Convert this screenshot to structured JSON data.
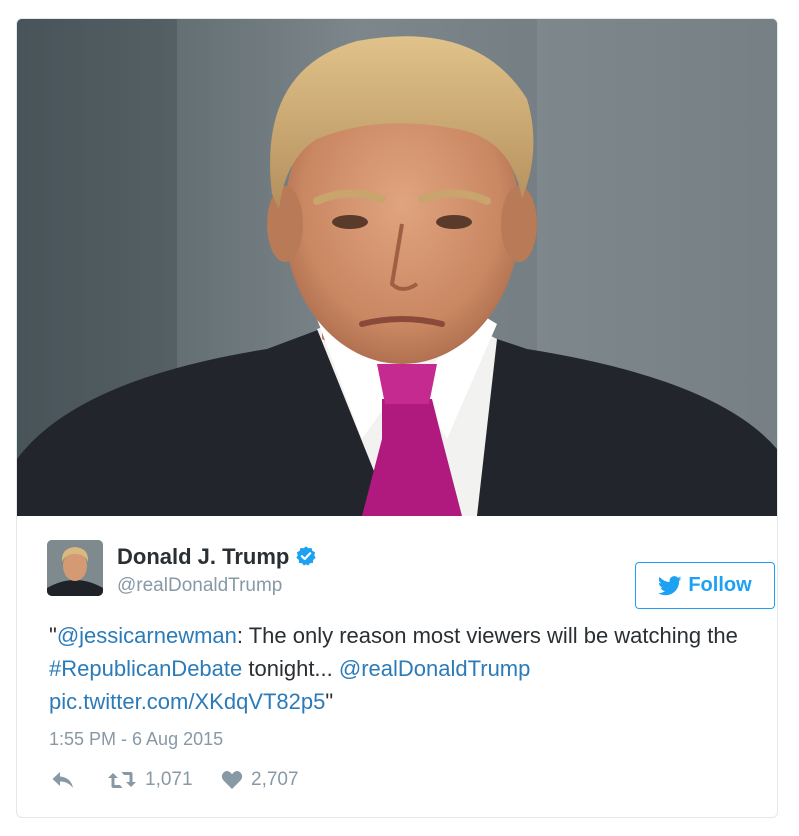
{
  "tweet": {
    "user": {
      "display_name": "Donald J. Trump",
      "handle": "@realDonaldTrump",
      "verified": true
    },
    "follow_button": {
      "label": "Follow",
      "icon": "twitter-bird-icon",
      "color": "#1da1f2"
    },
    "text": {
      "open_quote": "\"",
      "mention_1": "@jessicarnewman",
      "part_1": ": The only reason most viewers will be watching the ",
      "hashtag": "#RepublicanDebate",
      "part_2": " tonight... ",
      "mention_2": "@realDonaldTrump",
      "space": " ",
      "pic_link": "pic.twitter.com/XKdqVT82p5",
      "close_quote": "\""
    },
    "timestamp": "1:55 PM - 6 Aug 2015",
    "actions": {
      "reply_icon": "reply-icon",
      "retweet_icon": "retweet-icon",
      "retweet_count": "1,071",
      "like_icon": "heart-icon",
      "like_count": "2,707"
    },
    "colors": {
      "link": "#2b7bb9",
      "muted": "#8899a6",
      "text": "#292f33",
      "tie": "#b0197e"
    }
  }
}
